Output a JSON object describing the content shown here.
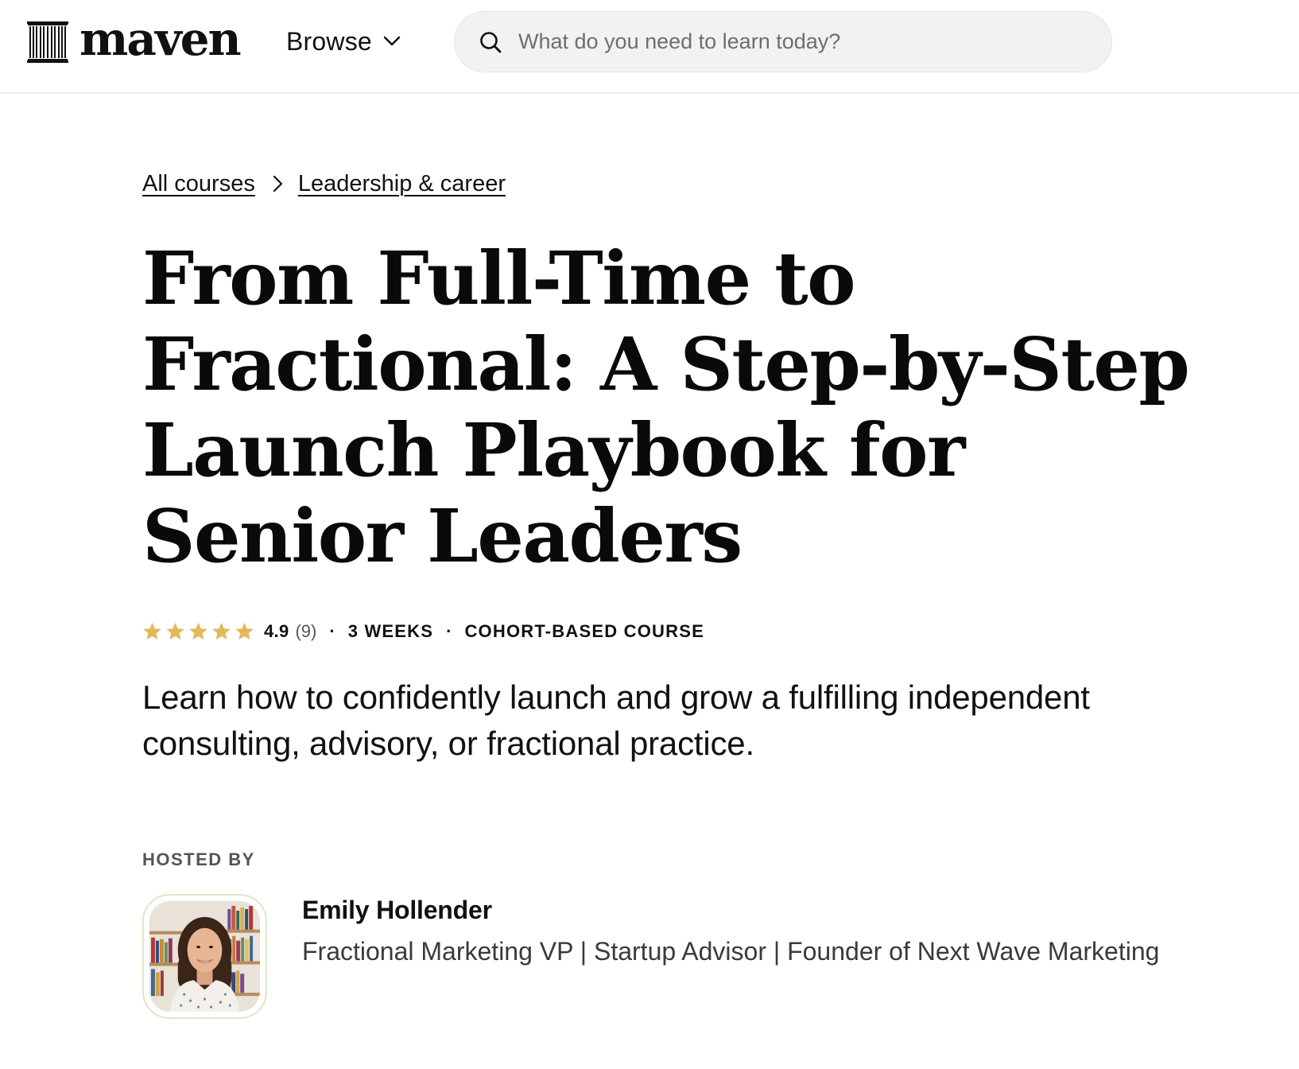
{
  "header": {
    "logo_text": "maven",
    "logo_icon": "columns-logo-icon",
    "browse_label": "Browse",
    "browse_icon": "chevron-down-icon",
    "search": {
      "icon": "search-icon",
      "placeholder": "What do you need to learn today?",
      "value": ""
    }
  },
  "breadcrumb": {
    "items": [
      {
        "label": "All courses"
      },
      {
        "label": "Leadership & career"
      }
    ],
    "separator_icon": "chevron-right-icon"
  },
  "course": {
    "title": "From Full-Time to Fractional: A Step-by-Step Launch Playbook for Senior Leaders",
    "rating": {
      "value": "4.9",
      "count_label": "(9)",
      "stars_filled": 5,
      "stars_total": 5,
      "star_icon": "star-icon",
      "star_color": "#e2b85a"
    },
    "separator": "·",
    "duration": "3 WEEKS",
    "format": "COHORT-BASED COURSE",
    "description": "Learn how to confidently launch and grow a fulfilling independent consulting, advisory, or fractional practice."
  },
  "host_section": {
    "label": "HOSTED BY",
    "host": {
      "name": "Emily Hollender",
      "bio": "Fractional Marketing VP | Startup Advisor | Founder of Next Wave Marketing",
      "avatar": "host-avatar-photo"
    }
  },
  "colors": {
    "text": "#111111",
    "muted": "#555555",
    "search_bg": "#f2f2f2",
    "star": "#e2b85a",
    "avatar_border": "#dfe6c8"
  }
}
